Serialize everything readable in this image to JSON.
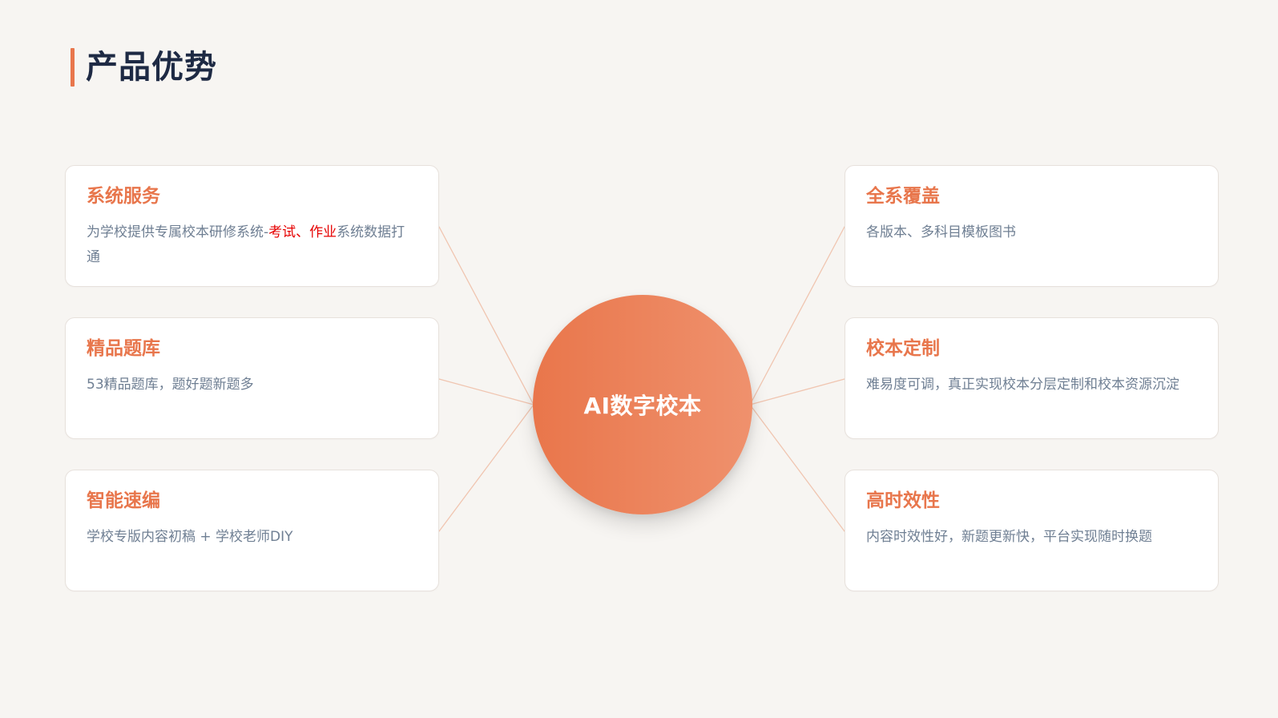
{
  "page": {
    "title": "产品优势"
  },
  "hub": {
    "label": "AI数字校本"
  },
  "cards": [
    {
      "title": "系统服务",
      "desc_prefix": "为学校提供专属校本研修系统-",
      "desc_highlight_1": "考试",
      "desc_separator": "、",
      "desc_highlight_2": "作业",
      "desc_suffix": "系统数据打通"
    },
    {
      "title": "精品题库",
      "desc": "53精品题库，题好题新题多"
    },
    {
      "title": "智能速编",
      "desc": "学校专版内容初稿 + 学校老师DIY"
    },
    {
      "title": "全系覆盖",
      "desc": "各版本、多科目模板图书"
    },
    {
      "title": "校本定制",
      "desc": "难易度可调，真正实现校本分层定制和校本资源沉淀"
    },
    {
      "title": "高时效性",
      "desc": "内容时效性好，新题更新快，平台实现随时换题"
    }
  ],
  "colors": {
    "accent": "#e8764c",
    "highlight": "#e60000",
    "title": "#1e2a44",
    "text": "#6f7f93",
    "background": "#f7f5f2",
    "line": "#f0c5b0"
  }
}
